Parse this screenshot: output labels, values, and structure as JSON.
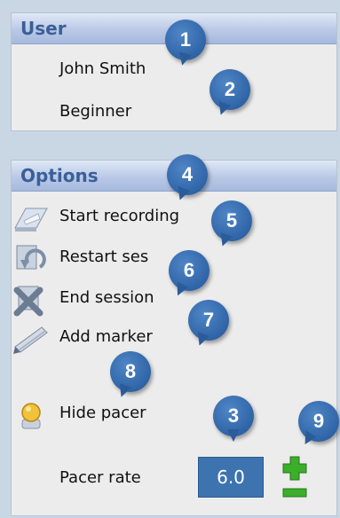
{
  "user": {
    "header": "User",
    "name": "John Smith",
    "level": "Beginner"
  },
  "options": {
    "header": "Options",
    "start_recording": "Start recording",
    "restart_session": "Restart ses",
    "end_session": "End session",
    "add_marker": "Add marker",
    "hide_pacer": "Hide pacer",
    "pacer_rate_label": "Pacer rate",
    "pacer_rate_value": "6.0"
  },
  "badges": [
    "1",
    "2",
    "3",
    "4",
    "5",
    "6",
    "7",
    "8",
    "9"
  ],
  "colors": {
    "header_text": "#3b5f98",
    "badge": "#2f64a6",
    "pacer_box": "#3d74b0",
    "plus_minus": "#3dae2b"
  }
}
